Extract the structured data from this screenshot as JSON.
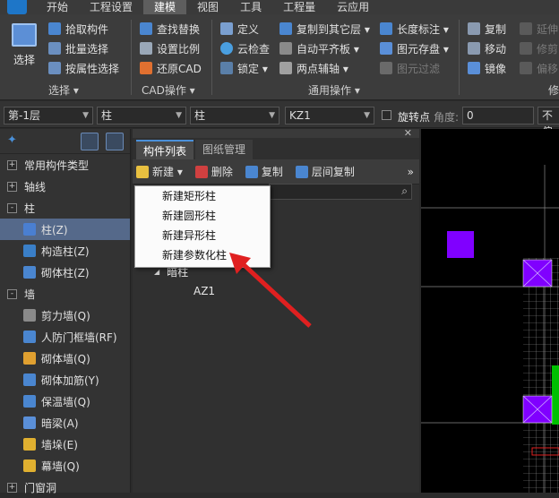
{
  "menubar": {
    "items": [
      "开始",
      "工程设置",
      "建模",
      "视图",
      "工具",
      "工程量",
      "云应用"
    ],
    "active": "建模"
  },
  "ribbon": {
    "select_label": "选择",
    "select_group": {
      "items": [
        "拾取构件",
        "批量选择",
        "按属性选择"
      ],
      "group_label": "选择 ▾"
    },
    "cad_group": {
      "items": [
        "查找替换",
        "设置比例",
        "还原CAD"
      ],
      "group_label": "CAD操作 ▾"
    },
    "common_group": {
      "col1": [
        "定义",
        "云检查",
        "锁定 ▾"
      ],
      "col2": [
        "复制到其它层 ▾",
        "自动平齐板 ▾",
        "两点辅轴 ▾"
      ],
      "col3": [
        "长度标注 ▾",
        "图元存盘 ▾",
        "图元过滤"
      ],
      "group_label": "通用操作 ▾"
    },
    "modify_group": {
      "col1": [
        "复制",
        "移动",
        "镜像"
      ],
      "col2": [
        "延伸",
        "修剪",
        "偏移"
      ],
      "group_label": "修"
    }
  },
  "props": {
    "floor": "第-1层",
    "category": "柱",
    "type": "柱",
    "component": "KZ1",
    "rotate_label": "旋转点",
    "angle_label": "角度:",
    "angle_value": "0",
    "last_value": "不偏"
  },
  "nav": {
    "items": [
      {
        "label": "常用构件类型",
        "level": 0,
        "plus": "+",
        "selected": false
      },
      {
        "label": "轴线",
        "level": 0,
        "plus": "+",
        "selected": false
      },
      {
        "label": "柱",
        "level": 0,
        "plus": "-",
        "selected": false
      },
      {
        "label": "柱(Z)",
        "level": 1,
        "icon": "#4a7fd1",
        "selected": true
      },
      {
        "label": "构造柱(Z)",
        "level": 1,
        "icon": "#3a7fc8",
        "selected": false
      },
      {
        "label": "砌体柱(Z)",
        "level": 1,
        "icon": "#4a86d0",
        "selected": false
      },
      {
        "label": "墙",
        "level": 0,
        "plus": "-",
        "selected": false
      },
      {
        "label": "剪力墙(Q)",
        "level": 1,
        "icon": "#8a8a8a",
        "selected": false
      },
      {
        "label": "人防门框墙(RF)",
        "level": 1,
        "icon": "#4a86d0",
        "selected": false
      },
      {
        "label": "砌体墙(Q)",
        "level": 1,
        "icon": "#e0a030",
        "selected": false
      },
      {
        "label": "砌体加筋(Y)",
        "level": 1,
        "icon": "#4a86d0",
        "selected": false
      },
      {
        "label": "保温墙(Q)",
        "level": 1,
        "icon": "#4a86d0",
        "selected": false
      },
      {
        "label": "暗梁(A)",
        "level": 1,
        "icon": "#5a8fd8",
        "selected": false
      },
      {
        "label": "墙垛(E)",
        "level": 1,
        "icon": "#e0b030",
        "selected": false
      },
      {
        "label": "幕墙(Q)",
        "level": 1,
        "icon": "#e0b030",
        "selected": false
      },
      {
        "label": "门窗洞",
        "level": 0,
        "plus": "+",
        "selected": false
      }
    ]
  },
  "component_list": {
    "tabs": [
      "构件列表",
      "图纸管理"
    ],
    "active_tab": "构件列表",
    "toolbar": {
      "new": "新建 ▾",
      "delete": "删除",
      "copy": "复制",
      "floor_copy": "层间复制",
      "more": "»"
    },
    "tree_group": "暗柱",
    "tree_item": "AZ1"
  },
  "new_menu": {
    "items": [
      "新建矩形柱",
      "新建圆形柱",
      "新建异形柱",
      "新建参数化柱"
    ]
  },
  "colors": {
    "accent": "#4a90d9",
    "annotation_arrow": "#e02020",
    "canvas_purple": "#8000ff",
    "canvas_green": "#00c000"
  }
}
